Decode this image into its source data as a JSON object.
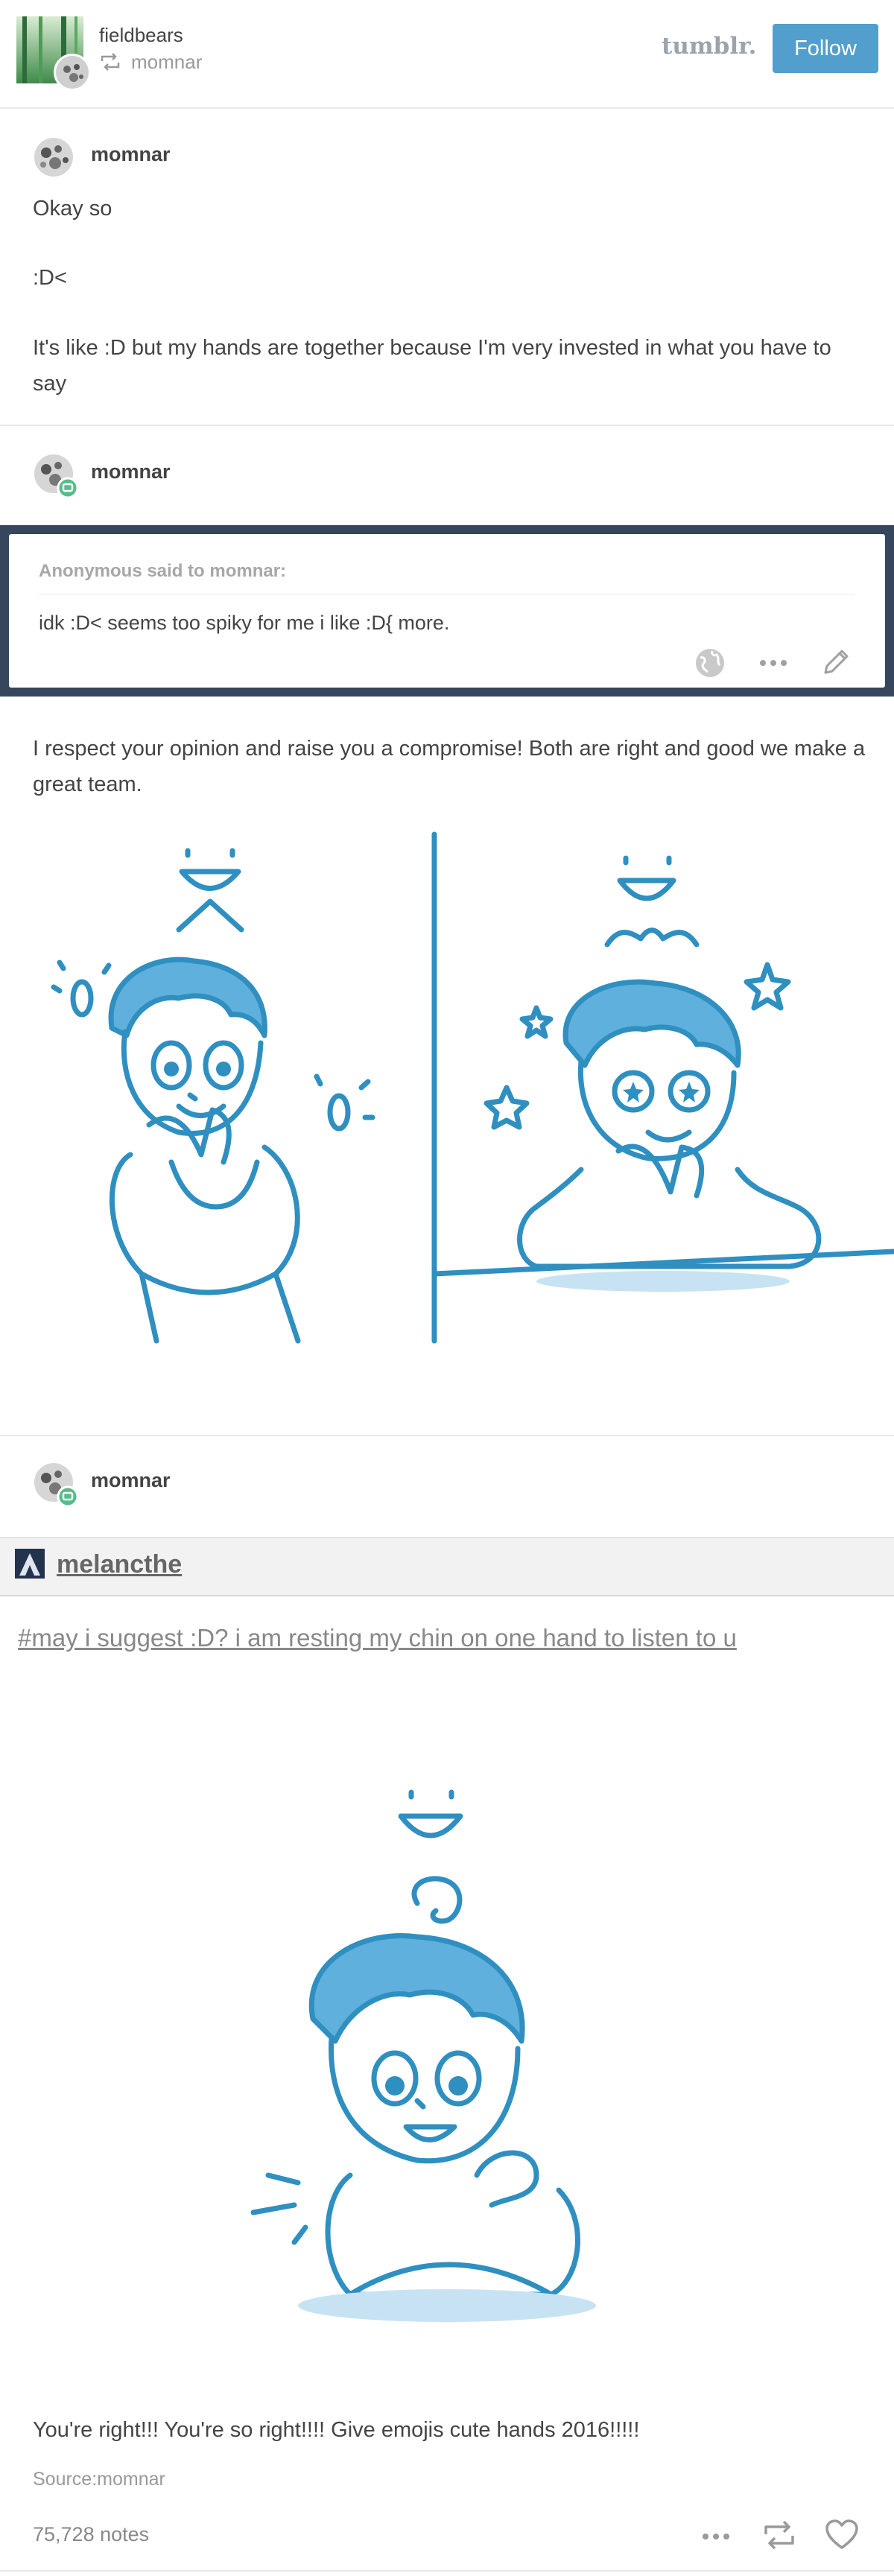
{
  "header": {
    "blog_name": "fieldbears",
    "reblogged_from": "momnar",
    "reblog_icon": "reblog-icon",
    "logo_text": "tumblr.",
    "follow_label": "Follow",
    "follow_color": "#529ecc"
  },
  "post1": {
    "username": "momnar",
    "paragraphs": [
      "Okay so",
      ":D<",
      "It's like :D but my hands are together because I'm very invested in what you have to say"
    ]
  },
  "post2": {
    "username": "momnar",
    "ask": {
      "asker_line": "Anonymous said to momnar:",
      "question": "idk :D< seems too spiky for me i like :D{ more.",
      "frame_color": "#36465d"
    },
    "answer": "I respect your opinion and raise you a compromise! Both are right and good we make a great team.",
    "comic_left_emoji": ":D<",
    "comic_right_emoji": ":D{"
  },
  "post3": {
    "username": "momnar",
    "reblog_username": "melancthe",
    "tag_line": "#may i suggest :D? i am resting my chin on one hand to listen to u",
    "reply": "You're right!!! You're so right!!!! Give emojis cute hands 2016!!!!!",
    "source_label": "Source:",
    "source_name": "momnar"
  },
  "footer": {
    "notes": "75,728 notes",
    "icons": [
      "more-icon",
      "reblog-icon",
      "like-icon"
    ]
  },
  "colors": {
    "accent": "#529ecc",
    "drawing_blue": "#2f8fc0",
    "text": "#444444",
    "muted": "#999999"
  }
}
